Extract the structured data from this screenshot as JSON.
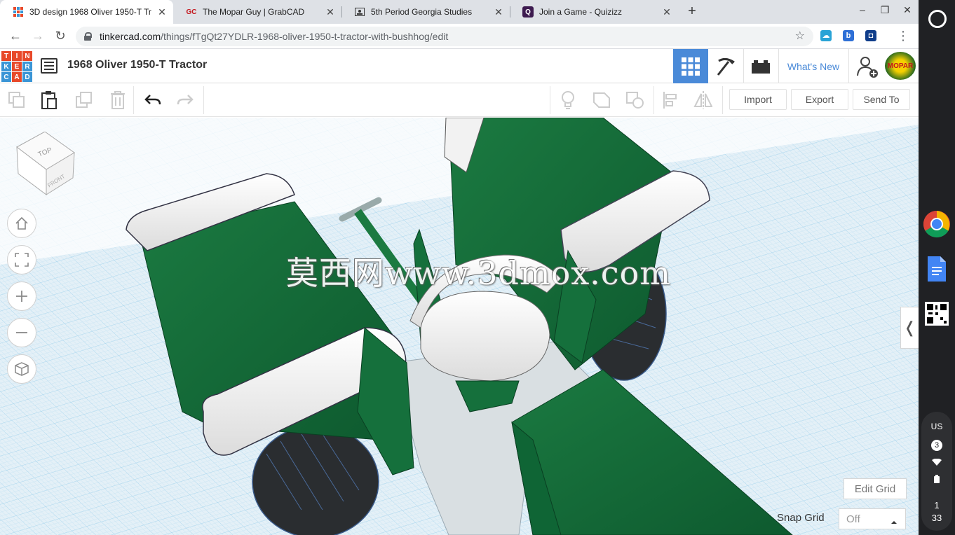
{
  "browser": {
    "tabs": [
      {
        "title": "3D design 1968 Oliver 1950-T Tr",
        "favicon": "tinkercad-favicon",
        "active": true
      },
      {
        "title": "The Mopar Guy | GrabCAD",
        "favicon": "GC",
        "active": false
      },
      {
        "title": "5th Period Georgia Studies",
        "favicon": "classroom-favicon",
        "active": false
      },
      {
        "title": "Join a Game - Quizizz",
        "favicon": "Q",
        "active": false
      }
    ],
    "new_tab": "+",
    "url_domain": "tinkercad.com",
    "url_path": "/things/fTgQt27YDLR-1968-oliver-1950-t-tractor-with-bushhog/edit"
  },
  "header": {
    "logo_letters": [
      "T",
      "I",
      "N",
      "K",
      "E",
      "R",
      "C",
      "A",
      "D"
    ],
    "logo_colors": [
      "#e8492a",
      "#e8492a",
      "#e8492a",
      "#3a95d6",
      "#e8492a",
      "#3a95d6",
      "#3a95d6",
      "#e8492a",
      "#3a95d6"
    ],
    "design_title": "1968 Oliver 1950-T Tractor",
    "whats_new": "What's New",
    "avatar_text": "MOPAR",
    "grid_accent": "#4a8ad8"
  },
  "toolbar": {
    "import_label": "Import",
    "export_label": "Export",
    "send_to_label": "Send To"
  },
  "viewport": {
    "viewcube_top": "TOP",
    "viewcube_front": "FRONT",
    "watermark": "莫西网www.3dmox.com",
    "edit_grid_label": "Edit Grid",
    "snap_grid_label": "Snap Grid",
    "snap_grid_value": "Off",
    "model_green": "#0f6535",
    "grid_color": "#a9d6ee"
  },
  "shelf": {
    "keyboard": "US",
    "notification_count": "3",
    "time_hour": "1",
    "time_minute": "33"
  }
}
